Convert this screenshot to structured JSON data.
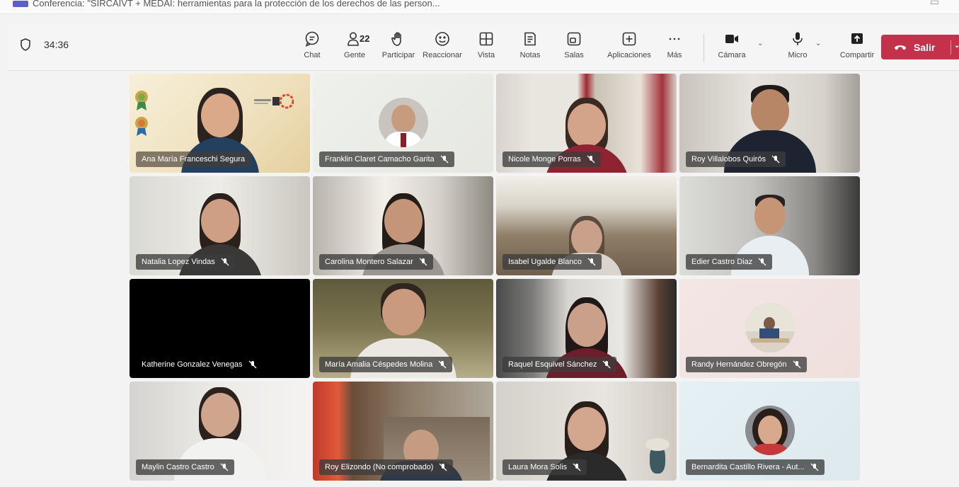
{
  "window": {
    "title": "Conferencia: \"SIRCAIVT + MEDAI: herramientas para la protección de los derechos de las person..."
  },
  "toolbar": {
    "timer": "34:36",
    "people_count": "22",
    "items": [
      {
        "label": "Chat",
        "icon": "chat-icon"
      },
      {
        "label": "Gente",
        "icon": "people-icon"
      },
      {
        "label": "Participar",
        "icon": "raise-hand-icon"
      },
      {
        "label": "Reaccionar",
        "icon": "smiley-icon"
      },
      {
        "label": "Vista",
        "icon": "grid-view-icon"
      },
      {
        "label": "Notas",
        "icon": "notes-icon"
      },
      {
        "label": "Salas",
        "icon": "rooms-icon"
      },
      {
        "label": "Aplicaciones",
        "icon": "add-apps-icon"
      },
      {
        "label": "Más",
        "icon": "more-icon"
      }
    ],
    "camera_label": "Cámara",
    "mic_label": "Micro",
    "share_label": "Compartir",
    "leave_label": "Salir",
    "leave_color": "#c4314b"
  },
  "participants": [
    {
      "name": "Ana María Franceschi Segura",
      "muted": false
    },
    {
      "name": "Franklin Claret Camacho Garita",
      "muted": true
    },
    {
      "name": "Nicole Monge Porras",
      "muted": true
    },
    {
      "name": "Roy Villalobos Quirós",
      "muted": true
    },
    {
      "name": "Natalia Lopez Vindas",
      "muted": true
    },
    {
      "name": "Carolina Montero Salazar",
      "muted": true
    },
    {
      "name": "Isabel Ugalde Blanco",
      "muted": true
    },
    {
      "name": "Edier Castro Diaz",
      "muted": true
    },
    {
      "name": "Katherine Gonzalez Venegas",
      "muted": true
    },
    {
      "name": "María Amalia Céspedes Molina",
      "muted": true
    },
    {
      "name": "Raquel Esquivel Sánchez",
      "muted": true
    },
    {
      "name": "Randy Hernández Obregón",
      "muted": true
    },
    {
      "name": "Maylin Castro Castro",
      "muted": true
    },
    {
      "name": "Roy Elizondo (No comprobado)",
      "muted": true
    },
    {
      "name": "Laura Mora Solis",
      "muted": true
    },
    {
      "name": "Bernardita Castillo Rivera - Aut...",
      "muted": true
    }
  ]
}
